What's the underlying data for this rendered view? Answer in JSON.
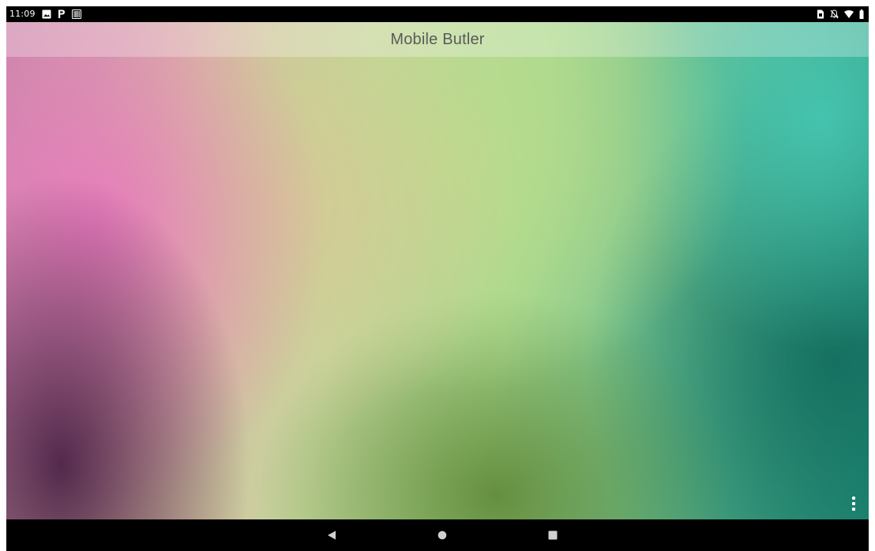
{
  "status_bar": {
    "time": "11:09",
    "left_icons": [
      "image-notification-icon",
      "parking-app-icon",
      "barcode-notification-icon"
    ],
    "right_icons": [
      "sim-card-icon",
      "notifications-muted-icon",
      "wifi-icon",
      "battery-icon"
    ]
  },
  "app": {
    "title": "Mobile Butler",
    "overflow_icon": "overflow-menu-icon"
  },
  "nav_bar": {
    "buttons": [
      "back-icon",
      "home-icon",
      "recents-icon"
    ]
  },
  "colors": {
    "status_bar_bg": "#000000",
    "nav_bar_bg": "#000000",
    "title_text": "#5a5a5a",
    "icon_white": "#ffffff",
    "nav_icon": "#d0d0d0"
  }
}
